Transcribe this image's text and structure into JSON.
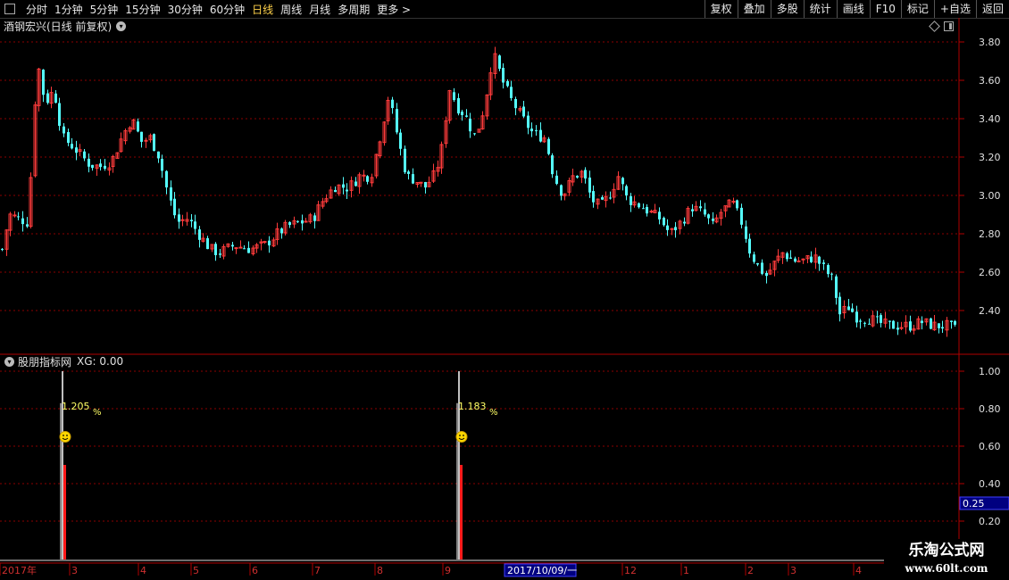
{
  "toolbar": {
    "tabs": [
      "分时",
      "1分钟",
      "5分钟",
      "15分钟",
      "30分钟",
      "60分钟",
      "日线",
      "周线",
      "月线",
      "多周期",
      "更多 >"
    ],
    "active_tab": "日线",
    "right_buttons": [
      "复权",
      "叠加",
      "多股",
      "统计",
      "画线",
      "F10",
      "标记",
      "+自选",
      "返回"
    ]
  },
  "main_chart": {
    "title": "酒钢宏兴(日线 前复权)",
    "y_ticks": [
      "3.80",
      "3.60",
      "3.40",
      "3.20",
      "3.00",
      "2.80",
      "2.60",
      "2.40"
    ],
    "colors": {
      "up": "#ff3b3b",
      "down": "#54fcfc",
      "grid": "#8b0000",
      "axis": "#b00000"
    }
  },
  "indicator": {
    "name": "股朋指标网",
    "xg": "XG: 0.00",
    "y_ticks": [
      "1.00",
      "0.80",
      "0.60",
      "0.40",
      "0.20"
    ],
    "current_value": "0.25",
    "labels": [
      "1.205",
      "1.183"
    ],
    "percent": "%"
  },
  "x_axis": {
    "labels": [
      "2017年",
      "3",
      "4",
      "5",
      "6",
      "7",
      "8",
      "9",
      "12",
      "1",
      "2",
      "3",
      "4"
    ],
    "highlight": "2017/10/09/一"
  },
  "watermark": {
    "line1": "乐淘公式网",
    "line2": "www.60lt.com"
  }
}
